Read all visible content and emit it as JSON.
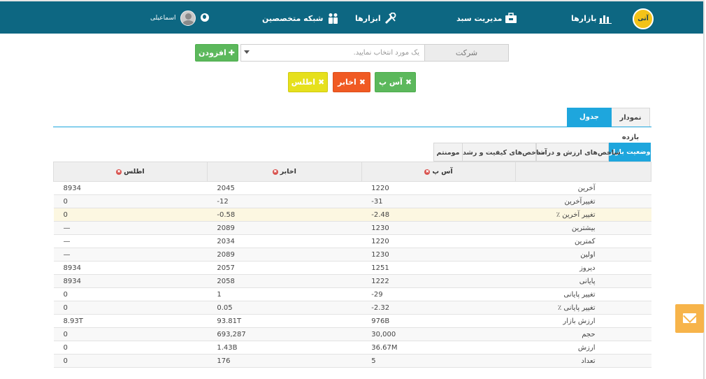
{
  "nav": {
    "logo_text": "آتی",
    "items": [
      {
        "label": "بازارها",
        "icon": "bar-chart-icon"
      },
      {
        "label": "مدیریت سبد",
        "icon": "briefcase-icon"
      },
      {
        "label": "ابزارها",
        "icon": "tools-icon"
      },
      {
        "label": "شبکه متخصصین",
        "icon": "people-icon"
      }
    ],
    "user_name": "اسماعیلی"
  },
  "selector": {
    "company_label": "شرکت",
    "placeholder": "یک مورد انتخاب نمایید.",
    "add_label": "افزودن"
  },
  "chips": [
    {
      "label": "آس پ",
      "color": "#5cb85c"
    },
    {
      "label": "اخابر",
      "color": "#f05a23"
    },
    {
      "label": "اطلس",
      "color": "#e6e01d"
    }
  ],
  "view_tabs": {
    "chart": "نمودار بازده",
    "table": "جدول مقایسه"
  },
  "sub_tabs": {
    "market": "وضعیت بازار",
    "value": "شاخص‌های ارزش و درآمد",
    "quality": "شاخص‌های کیفیت و رشد",
    "momentum": "مومنتم"
  },
  "table": {
    "columns": [
      "آس پ",
      "اخابر",
      "اطلس"
    ],
    "rows": [
      {
        "label": "آخرین",
        "values": [
          "1220",
          "2045",
          "8934"
        ]
      },
      {
        "label": "تغییرآخرین",
        "values": [
          "-31",
          "-12",
          "0"
        ]
      },
      {
        "label": "تغییر آخرین ٪",
        "values": [
          "-2.48",
          "-0.58",
          "0"
        ]
      },
      {
        "label": "بیشترین",
        "values": [
          "1230",
          "2089",
          "—"
        ]
      },
      {
        "label": "کمترین",
        "values": [
          "1220",
          "2034",
          "—"
        ]
      },
      {
        "label": "اولین",
        "values": [
          "1230",
          "2089",
          "—"
        ]
      },
      {
        "label": "دیروز",
        "values": [
          "1251",
          "2057",
          "8934"
        ]
      },
      {
        "label": "پایانی",
        "values": [
          "1222",
          "2058",
          "8934"
        ]
      },
      {
        "label": "تغییر پایانی",
        "values": [
          "-29",
          "1",
          "0"
        ]
      },
      {
        "label": "تغییر پایانی ٪",
        "values": [
          "-2.32",
          "0.05",
          "0"
        ]
      },
      {
        "label": "ارزش بازار",
        "values": [
          "976B",
          "93.81T",
          "8.93T"
        ]
      },
      {
        "label": "حجم",
        "values": [
          "30,000",
          "693,287",
          "0"
        ]
      },
      {
        "label": "ارزش",
        "values": [
          "36.67M",
          "1.43B",
          "0"
        ]
      },
      {
        "label": "تعداد",
        "values": [
          "5",
          "176",
          "0"
        ]
      }
    ]
  }
}
